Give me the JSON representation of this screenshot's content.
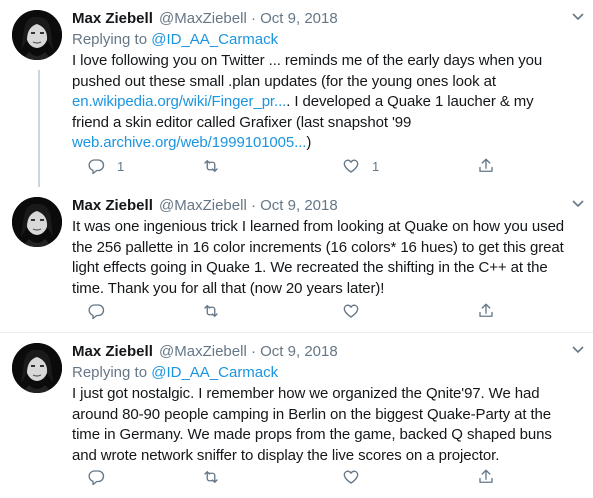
{
  "colors": {
    "accent": "#1b95e0",
    "secondary_text": "#657786",
    "divider": "#e6ecf0",
    "thread_line": "#ccd6dd"
  },
  "tweets": [
    {
      "author_name": "Max Ziebell",
      "handle": "@MaxZiebell",
      "separator": "·",
      "date": "Oct 9, 2018",
      "replying_prefix": "Replying to",
      "replying_to": "@ID_AA_Carmack",
      "line1": "I love following you on Twitter ... reminds me of the early days when you",
      "line2": "pushed out these small .plan updates (for the young ones look at",
      "link1": "en.wikipedia.org/wiki/Finger_pr...",
      "line3_rest": ". I developed a Quake 1 laucher & my",
      "line4": "friend a skin editor called Grafixer (last snapshot '99",
      "link2": "web.archive.org/web/1999101005...",
      "line5_rest": ")",
      "reply_count": "1",
      "retweet_count": "",
      "like_count": "1",
      "icons": [
        "reply-icon",
        "retweet-icon",
        "like-icon",
        "share-icon"
      ]
    },
    {
      "author_name": "Max Ziebell",
      "handle": "@MaxZiebell",
      "separator": "·",
      "date": "Oct 9, 2018",
      "line1": "It was one ingenious trick I learned from looking at Quake on how you used",
      "line2": "the 256 pallette in 16 color increments (16 colors* 16 hues) to get this great",
      "line3": "light effects going in Quake 1. We recreated the shifting in the C++ at the",
      "line4": "time. Thank you for all that (now 20 years later)!",
      "reply_count": "",
      "retweet_count": "",
      "like_count": ""
    },
    {
      "author_name": "Max Ziebell",
      "handle": "@MaxZiebell",
      "separator": "·",
      "date": "Oct 9, 2018",
      "replying_prefix": "Replying to",
      "replying_to": "@ID_AA_Carmack",
      "line1": "I just got nostalgic. I remember how we organized the Qnite'97. We had",
      "line2": "around 80-90 people camping in Berlin on the biggest Quake-Party at the",
      "line3": "time in Germany. We made props from the game, backed Q shaped buns",
      "line4": "and wrote network sniffer to display the live scores on a projector.",
      "reply_count": "",
      "retweet_count": "",
      "like_count": ""
    }
  ]
}
